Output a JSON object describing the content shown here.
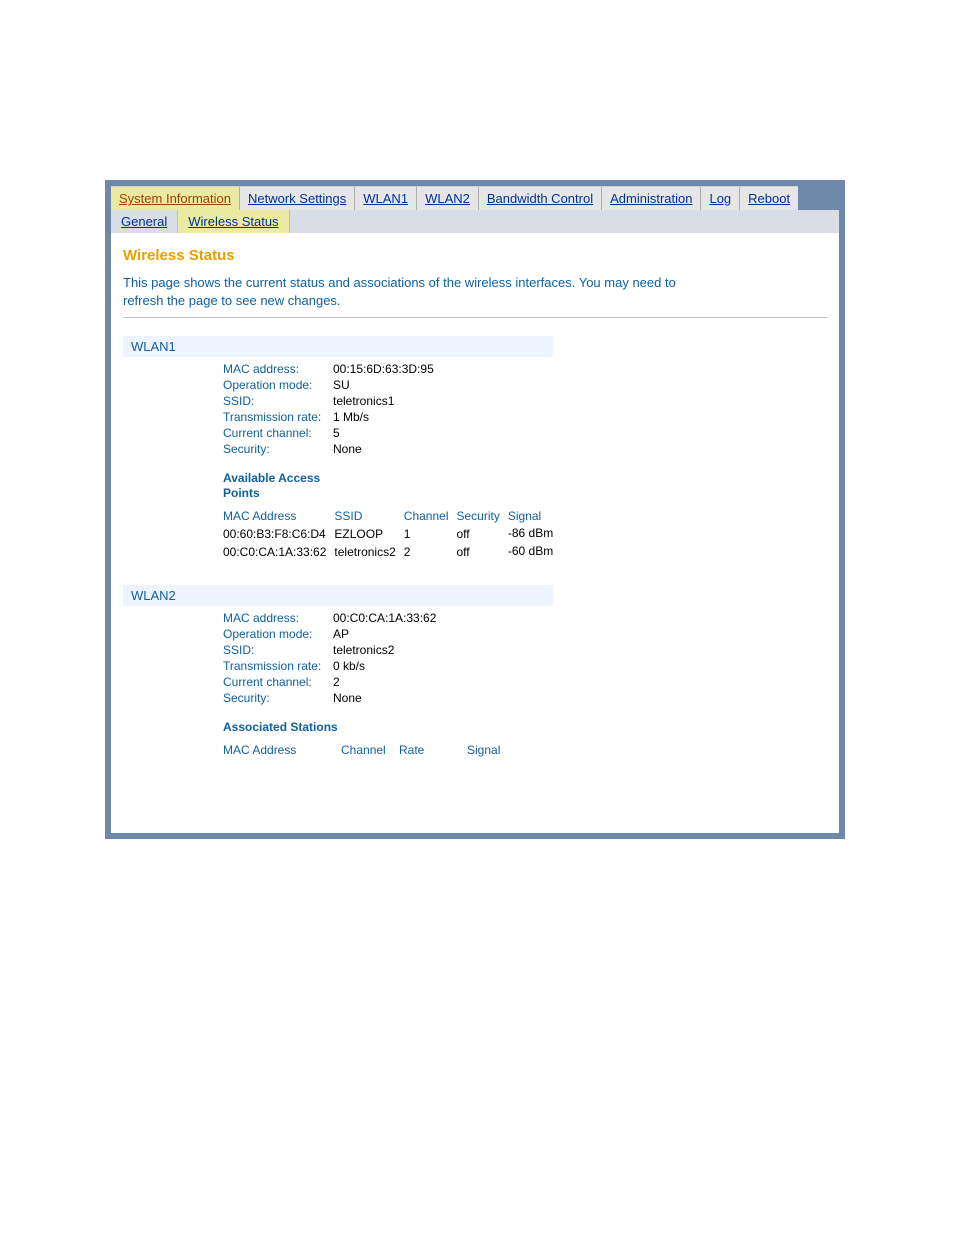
{
  "nav": {
    "tabs": [
      "System Information",
      "Network Settings",
      "WLAN1",
      "WLAN2",
      "Bandwidth Control",
      "Administration",
      "Log",
      "Reboot"
    ],
    "subtabs": [
      "General",
      "Wireless Status"
    ]
  },
  "page": {
    "title": "Wireless Status",
    "description": "This page shows the current status and associations of the wireless interfaces. You may need to refresh the page to see new changes."
  },
  "labels": {
    "mac": "MAC address:",
    "mode": "Operation mode:",
    "ssid": "SSID:",
    "rate": "Transmission rate:",
    "channel": "Current channel:",
    "security": "Security:"
  },
  "wlan1": {
    "header": "WLAN1",
    "mac": "00:15:6D:63:3D:95",
    "mode": "SU",
    "ssid": "teletronics1",
    "rate": "1 Mb/s",
    "channel": "5",
    "security": "None",
    "ap_title": "Available Access Points",
    "ap_cols": {
      "mac": "MAC Address",
      "ssid": "SSID",
      "channel": "Channel",
      "security": "Security",
      "signal": "Signal"
    },
    "aps": [
      {
        "mac": "00:60:B3:F8:C6:D4",
        "ssid": "EZLOOP",
        "channel": "1",
        "security": "off",
        "signal": "-86 dBm"
      },
      {
        "mac": "00:C0:CA:1A:33:62",
        "ssid": "teletronics2",
        "channel": "2",
        "security": "off",
        "signal": "-60 dBm"
      }
    ]
  },
  "wlan2": {
    "header": "WLAN2",
    "mac": "00:C0:CA:1A:33:62",
    "mode": "AP",
    "ssid": "teletronics2",
    "rate": "0 kb/s",
    "channel": "2",
    "security": "None",
    "assoc_title": "Associated Stations",
    "assoc_cols": {
      "mac": "MAC Address",
      "channel": "Channel",
      "rate": "Rate",
      "signal": "Signal"
    }
  }
}
